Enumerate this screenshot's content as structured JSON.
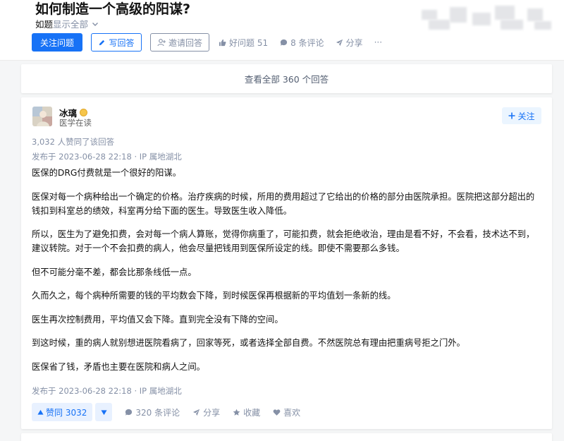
{
  "question": {
    "title": "如何制造一个高级的阳谋?",
    "topic": "如题",
    "show_all": "显示全部"
  },
  "actions": {
    "follow_question": "关注问题",
    "write_answer": "写回答",
    "invite_answer": "邀请回答",
    "good_question": "好问题 51",
    "comments": "8 条评论",
    "share": "分享",
    "more": "···"
  },
  "view_all_answers": "查看全部 360 个回答",
  "answer": {
    "author_name": "冰璃",
    "author_bio": "医学在读",
    "follow_label": "关注",
    "voters": "3,032 人赞同了该回答",
    "published_top": "发布于 2023-06-28 22:18 · IP 属地湖北",
    "published_bottom": "发布于 2023-06-28 22:18 · IP 属地湖北",
    "paragraphs": [
      "医保的DRG付费就是一个很好的阳谋。",
      "医保对每一个病种给出一个确定的价格。治疗疾病的时候，所用的费用超过了它给出的价格的部分由医院承担。医院把这部分超出的钱扣到科室总的绩效，科室再分给下面的医生。导致医生收入降低。",
      "所以，医生为了避免扣费，会对每一个病人算账，觉得你病重了，可能扣费，就会拒绝收治，理由是看不好，不会看，技术达不到，建议转院。对于一个不会扣费的病人，他会尽量把钱用到医保所设定的线。即使不需要那么多钱。",
      "但不可能分毫不差，都会比那条线低一点。",
      "久而久之，每个病种所需要的钱的平均数会下降，到时候医保再根据新的平均值划一条新的线。",
      "医生再次控制费用，平均值又会下降。直到完全没有下降的空间。",
      "到这时候，重的病人就别想进医院看病了，回家等死，或者选择全部自费。不然医院总有理由把重病号拒之门外。",
      "医保省了钱，矛盾也主要在医院和病人之间。"
    ],
    "vote_up": "赞同 3032",
    "comments": "320 条评论",
    "share": "分享",
    "collect": "收藏",
    "like": "喜欢"
  },
  "colors": {
    "brand_blue": "#1772f6",
    "meta_grey": "#8590a6",
    "page_bg": "#f5f6f7"
  },
  "icons": [
    "chevron-down-icon",
    "pencil-icon",
    "add-user-icon",
    "thumb-up-icon",
    "comment-icon",
    "share-icon",
    "plus-icon",
    "triangle-up-icon",
    "triangle-down-icon",
    "star-icon",
    "heart-icon",
    "badge-icon"
  ]
}
